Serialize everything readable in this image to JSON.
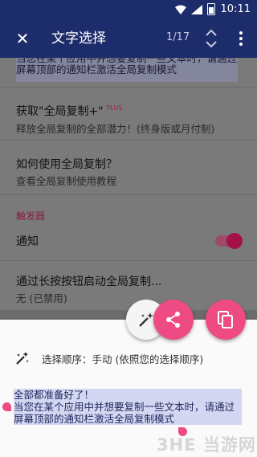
{
  "status": {
    "time": "10:11"
  },
  "appbar": {
    "title": "文字选择",
    "counter": "1/17"
  },
  "background": {
    "selected_lines": [
      "当您在某个应用中并想要复制一些文本时，请通过",
      "屏幕顶部的通知栏激活全局复制模式"
    ],
    "items": [
      {
        "title": "获取\"全局复制+\"",
        "badge": "PLUS",
        "subtitle": "释放全局复制的全部潜力！(终身版或月付制)"
      },
      {
        "title": "如何使用全局复制？",
        "subtitle": "查看全局复制使用教程"
      }
    ],
    "section_label": "触发器",
    "notify_label": "通知",
    "longpress_title": "通过长按按钮启动全局复制...",
    "longpress_sub": "无 (已禁用)"
  },
  "sheet": {
    "order_text": "选择顺序：手动 (依照您的选择顺序)",
    "preview_lines": [
      "全部都准备好了！",
      "当您在某个应用中并想要复制一些文本时，请通过",
      "屏幕顶部的通知栏激活全局复制模式"
    ],
    "watermark": "3HE 当游网"
  },
  "colors": {
    "accent": "#ee4a84",
    "appbar": "#1d2c6b",
    "selection": "#d4d7f1"
  }
}
